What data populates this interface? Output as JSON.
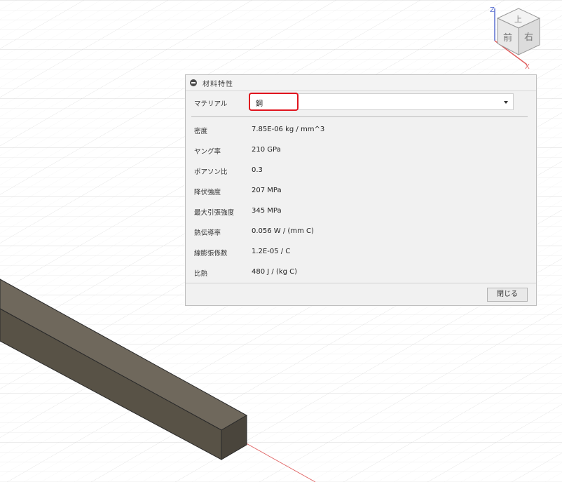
{
  "panel": {
    "title": "材料特性",
    "material_label": "マテリアル",
    "material_value": "鋼",
    "close_label": "閉じる"
  },
  "properties": [
    {
      "label": "密度",
      "value": "7.85E-06 kg / mm^3"
    },
    {
      "label": "ヤング率",
      "value": "210 GPa"
    },
    {
      "label": "ポアソン比",
      "value": "0.3"
    },
    {
      "label": "降伏強度",
      "value": "207 MPa"
    },
    {
      "label": "最大引張強度",
      "value": "345 MPa"
    },
    {
      "label": "熱伝導率",
      "value": "0.056 W / (mm C)"
    },
    {
      "label": "線膨張係数",
      "value": "1.2E-05 / C"
    },
    {
      "label": "比熱",
      "value": "480 J / (kg C)"
    }
  ],
  "viewcube": {
    "top": "上",
    "front": "前",
    "right": "右",
    "axis_z": "Z",
    "axis_x": "X"
  },
  "colors": {
    "highlight": "#e0141e",
    "beam_top": "#6f685c",
    "beam_side": "#585246",
    "beam_end": "#4a453c",
    "axis_x": "#e06060",
    "axis_z": "#5a6fd0"
  }
}
